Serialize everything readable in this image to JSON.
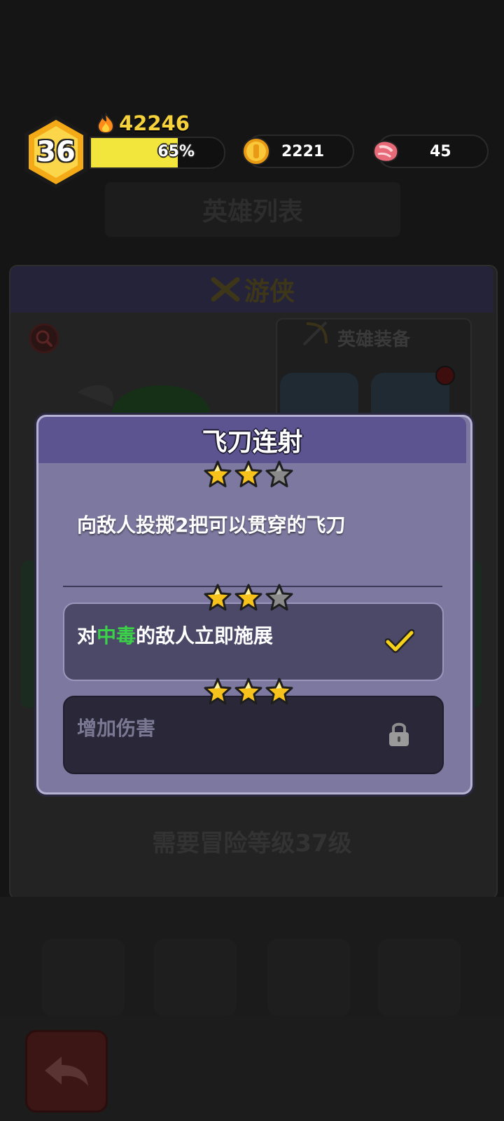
{
  "hud": {
    "level": "36",
    "power": "42246",
    "xp_percent_label": "65%",
    "xp_fraction": 0.65,
    "coins": "2221",
    "meat": "45"
  },
  "background": {
    "title": "英雄列表",
    "hero_name": "游侠",
    "equip_label": "英雄装备",
    "requirement": "需要冒险等级37级"
  },
  "modal": {
    "title": "飞刀连射",
    "stars_total": 3,
    "stars_filled": 2,
    "description": "向敌人投掷2把可以贯穿的飞刀",
    "options": [
      {
        "prefix": "对",
        "highlight": "中毒",
        "suffix": "的敌人立即施展",
        "stars_filled": 2,
        "status": "unlocked",
        "icon": "check-icon",
        "highlight_color": "#3bd24a"
      },
      {
        "text": "增加伤害",
        "stars_filled": 3,
        "status": "locked",
        "icon": "lock-icon"
      }
    ]
  },
  "colors": {
    "star_gold": "#f7c21c",
    "xp_bar": "#f2e53b",
    "modal_bg": "#7d789f",
    "modal_header": "#5c5490"
  }
}
